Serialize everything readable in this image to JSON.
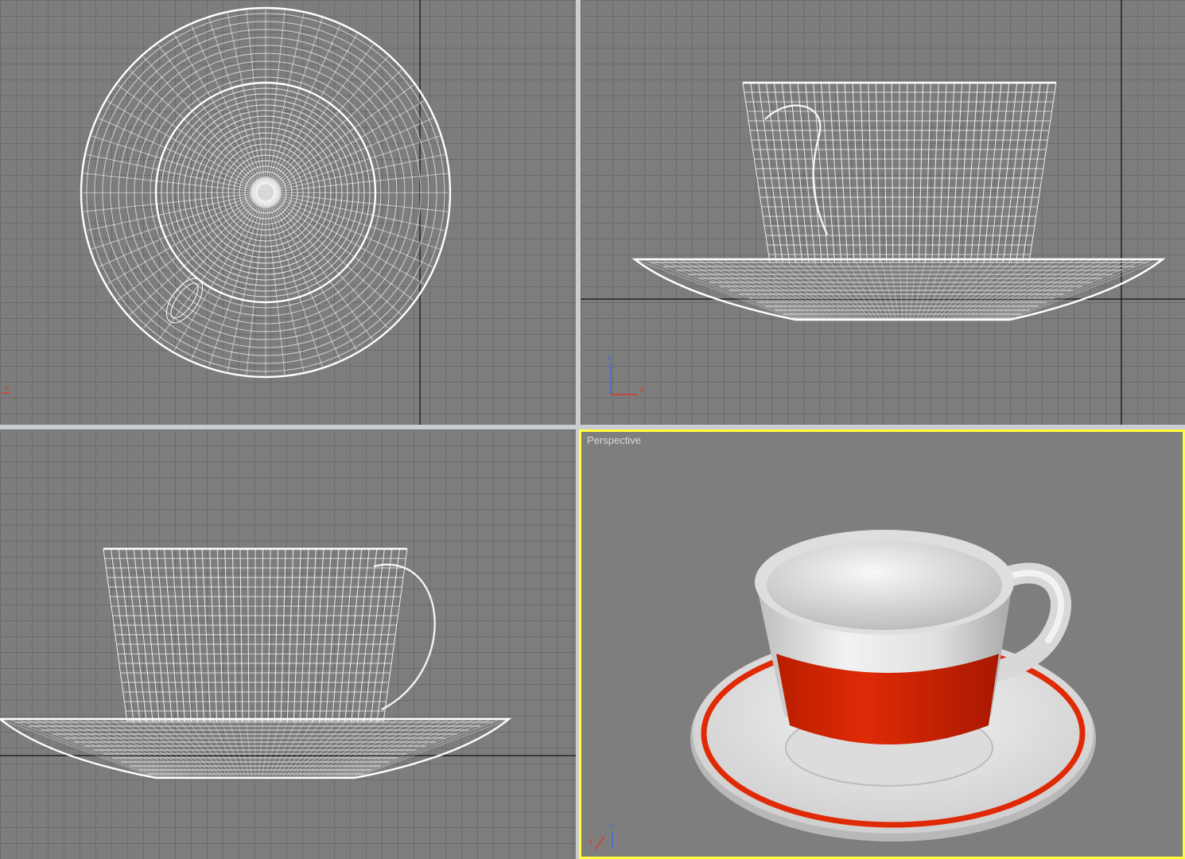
{
  "viewports": {
    "top": {
      "label": "",
      "view": "wireframe"
    },
    "front": {
      "label": "",
      "view": "wireframe"
    },
    "left": {
      "label": "",
      "view": "wireframe"
    },
    "perspective": {
      "label": "Perspective",
      "view": "smooth-shaded",
      "active": true
    }
  },
  "gizmo": {
    "top": {
      "x_label": "x"
    },
    "front": {
      "z_label": "z",
      "x_label": "x"
    },
    "perspective": {
      "z_label": "z",
      "x_label": "x"
    }
  },
  "colors": {
    "viewport_bg": "#7d7d7d",
    "grid_line": "#6c6c6c",
    "wire": "#ffffff",
    "active_border": "#ffff3c",
    "cup_body": "#e6e6e6",
    "stripe_red": "#d42a05"
  },
  "objects": [
    "cup",
    "saucer"
  ]
}
